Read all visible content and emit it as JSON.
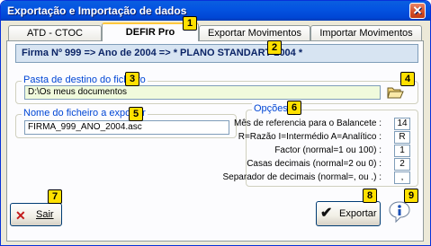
{
  "window": {
    "title": "Exportação e Importação de dados"
  },
  "tabs": [
    {
      "label": "ATD - CTOC",
      "active": false
    },
    {
      "label": "DEFIR Pro",
      "active": true
    },
    {
      "label": "Exportar Movimentos",
      "active": false
    },
    {
      "label": "Importar Movimentos",
      "active": false
    }
  ],
  "banner": {
    "text": "Firma Nº 999 => Ano de 2004 => * PLANO STANDART 2004 *"
  },
  "folder": {
    "legend": "Pasta de destino do ficheiro",
    "value": "D:\\Os meus documentos"
  },
  "filename": {
    "legend": "Nome do ficheiro a exportar",
    "value": "FIRMA_999_ANO_2004.asc"
  },
  "options": {
    "legend": "Opções",
    "rows": [
      {
        "label": "Mês de referencia para o Balancete :",
        "value": "14"
      },
      {
        "label": "R=Razão I=Intermédio A=Analítico :",
        "value": "R"
      },
      {
        "label": "Factor (normal=1 ou 100) :",
        "value": "1"
      },
      {
        "label": "Casas decimais (normal=2 ou 0) :",
        "value": "2"
      },
      {
        "label": "Separador de decimais (normal=, ou .) :",
        "value": ","
      }
    ]
  },
  "buttons": {
    "exit": "Sair",
    "export": "Exportar"
  },
  "badges": [
    "1",
    "2",
    "3",
    "4",
    "5",
    "6",
    "7",
    "8",
    "9"
  ],
  "colors": {
    "titlebar": "#0454e1",
    "badge": "#ffe000",
    "banner_bg": "#d7e4f2",
    "legend_text": "#0046d5"
  }
}
